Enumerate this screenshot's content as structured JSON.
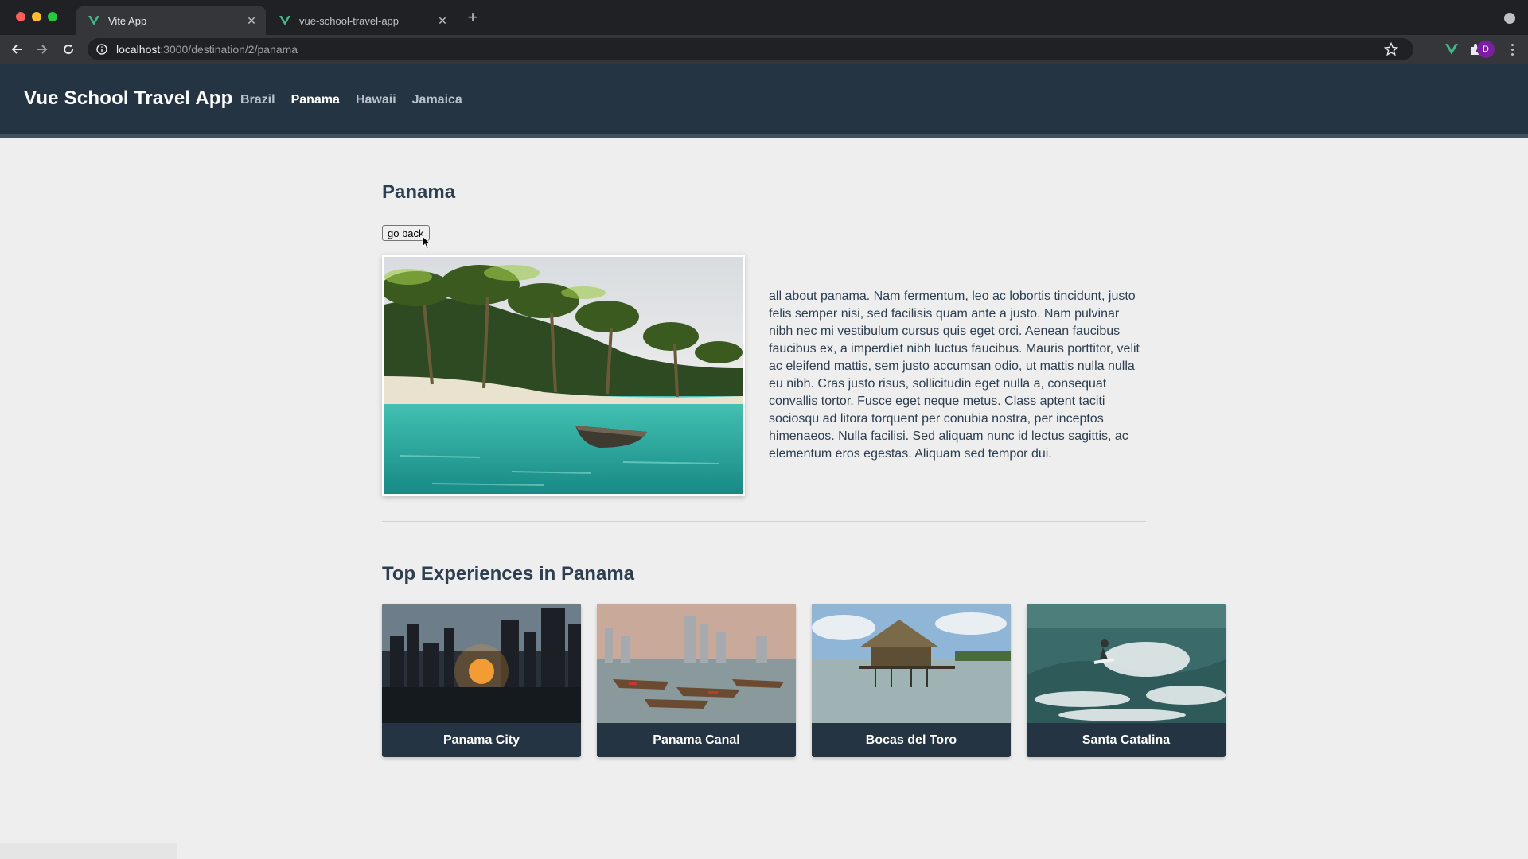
{
  "browser": {
    "tabs": [
      {
        "title": "Vite App",
        "active": true,
        "icon": "vue-icon"
      },
      {
        "title": "vue-school-travel-app",
        "active": false,
        "icon": "vue-icon"
      }
    ],
    "url_host": "localhost",
    "url_path": ":3000/destination/2/panama",
    "profile_initial": "D"
  },
  "header": {
    "brand": "Vue School Travel App",
    "nav": [
      "Brazil",
      "Panama",
      "Hawaii",
      "Jamaica"
    ],
    "active_nav": "Panama"
  },
  "destination": {
    "title": "Panama",
    "go_back_label": "go back",
    "description": "all about panama. Nam fermentum, leo ac lobortis tincidunt, justo felis semper nisi, sed facilisis quam ante a justo. Nam pulvinar nibh nec mi vestibulum cursus quis eget orci. Aenean faucibus faucibus ex, a imperdiet nibh luctus faucibus. Mauris porttitor, velit ac eleifend mattis, sem justo accumsan odio, ut mattis nulla nulla eu nibh. Cras justo risus, sollicitudin eget nulla a, consequat convallis tortor. Fusce eget neque metus. Class aptent taciti sociosqu ad litora torquent per conubia nostra, per inceptos himenaeos. Nulla facilisi. Sed aliquam nunc id lectus sagittis, ac elementum eros egestas. Aliquam sed tempor dui."
  },
  "experiences": {
    "title": "Top Experiences in Panama",
    "items": [
      {
        "name": "Panama City"
      },
      {
        "name": "Panama Canal"
      },
      {
        "name": "Bocas del Toro"
      },
      {
        "name": "Santa Catalina"
      }
    ]
  },
  "colors": {
    "header_bg": "#243443",
    "page_bg": "#eeeeee",
    "card_bg": "#243443",
    "vue_green": "#41b883"
  }
}
